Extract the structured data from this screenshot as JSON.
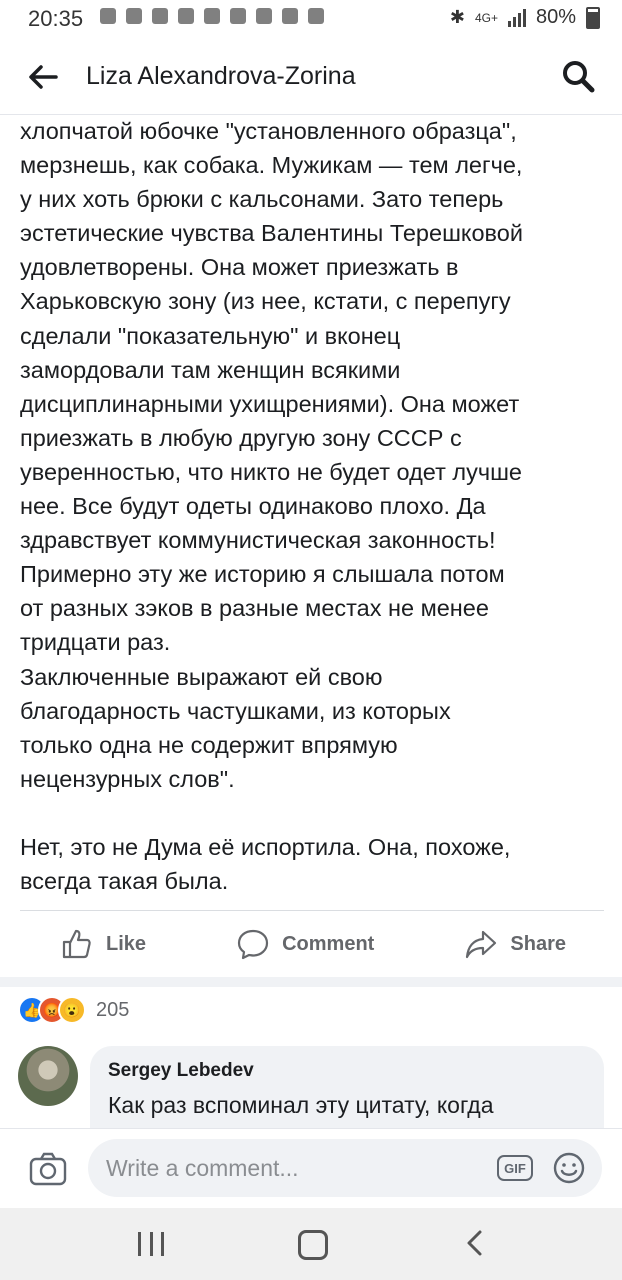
{
  "status_bar": {
    "time": "20:35",
    "network": "4G+",
    "battery": "80%"
  },
  "header": {
    "title": "Liza Alexandrova-Zorina",
    "back_icon": "arrow-left-icon",
    "search_icon": "search-icon"
  },
  "post": {
    "paragraphs": [
      "хлопчатой юбочке \"установленного образца\",\nмерзнешь, как собака. Мужикам — тем легче,\nу них хоть брюки с кальсонами. Зато теперь\nэстетические чувства Валентины Терешковой\nудовлетворены. Она может приезжать в\nХарьковскую зону (из нее, кстати, с перепугу\nсделали \"показательную\" и вконец\nзамордовали там женщин всякими\nдисциплинарными ухищрениями). Она может\nприезжать в любую другую зону СССР с\nуверенностью, что никто не будет одет лучше\nнее. Все будут одеты одинаково плохо. Да\nздравствует коммунистическая законность!\nПримерно эту же историю я слышала потом\nот разных зэков в разные местах не менее\nтридцати раз.\nЗаключенные выражают ей свою\nблагодарность частушками, из которых\nтолько одна не содержит впрямую\nнецензурных слов\".",
      "Нет, это не Дума её испортила. Она, похоже,\nвсегда такая была."
    ]
  },
  "actions": {
    "like": "Like",
    "comment": "Comment",
    "share": "Share"
  },
  "reactions": {
    "count": "205",
    "types": [
      "like",
      "angry",
      "wow"
    ]
  },
  "comment": {
    "author": "Sergey Lebedev",
    "text": "Как раз вспоминал эту цитату, когда"
  },
  "composer": {
    "placeholder": "Write a comment...",
    "gif_label": "GIF"
  },
  "colors": {
    "accent": "#1877f2",
    "text": "#1c1e21",
    "muted": "#65676b",
    "bubble": "#f0f2f5"
  }
}
